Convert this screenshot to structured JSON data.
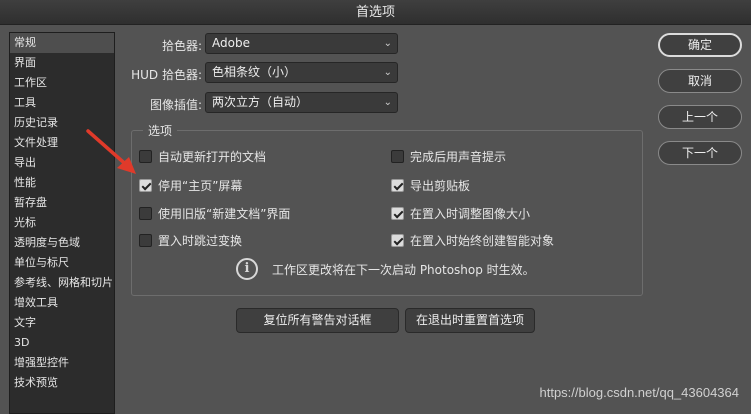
{
  "window": {
    "title": "首选项"
  },
  "sidebar": {
    "items": [
      {
        "label": "常规",
        "selected": true
      },
      {
        "label": "界面"
      },
      {
        "label": "工作区"
      },
      {
        "label": "工具"
      },
      {
        "label": "历史记录"
      },
      {
        "label": "文件处理"
      },
      {
        "label": "导出"
      },
      {
        "label": "性能"
      },
      {
        "label": "暂存盘"
      },
      {
        "label": "光标"
      },
      {
        "label": "透明度与色域"
      },
      {
        "label": "单位与标尺"
      },
      {
        "label": "参考线、网格和切片"
      },
      {
        "label": "增效工具"
      },
      {
        "label": "文字"
      },
      {
        "label": "3D"
      },
      {
        "label": "增强型控件"
      },
      {
        "label": "技术预览"
      }
    ]
  },
  "general": {
    "color_picker_label": "拾色器:",
    "color_picker_value": "Adobe",
    "hud_picker_label": "HUD 拾色器:",
    "hud_picker_value": "色相条纹（小）",
    "interpolation_label": "图像插值:",
    "interpolation_value": "两次立方（自动）"
  },
  "options": {
    "title": "选项",
    "left": [
      {
        "label": "自动更新打开的文档",
        "checked": false
      },
      {
        "label": "停用“主页”屏幕",
        "checked": true
      },
      {
        "label": "使用旧版“新建文档”界面",
        "checked": false
      },
      {
        "label": "置入时跳过变换",
        "checked": false
      }
    ],
    "right": [
      {
        "label": "完成后用声音提示",
        "checked": false
      },
      {
        "label": "导出剪贴板",
        "checked": true
      },
      {
        "label": "在置入时调整图像大小",
        "checked": true
      },
      {
        "label": "在置入时始终创建智能对象",
        "checked": true
      }
    ],
    "info_text": "工作区更改将在下一次启动 Photoshop 时生效。"
  },
  "buttons": {
    "reset_warnings": "复位所有警告对话框",
    "reset_on_quit": "在退出时重置首选项",
    "ok": "确定",
    "cancel": "取消",
    "prev": "上一个",
    "next": "下一个"
  },
  "watermark": "https://blog.csdn.net/qq_43604364",
  "colors": {
    "annotation_arrow": "#e03a2a",
    "background": "#535353"
  }
}
